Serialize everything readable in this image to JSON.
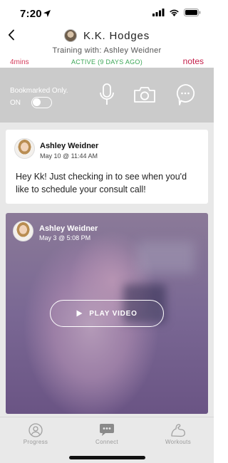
{
  "status_bar": {
    "time": "7:20"
  },
  "header": {
    "title": "K.K. Hodges",
    "trainer_line": "Training with: Ashley Weidner",
    "mins": "4mins",
    "active_status": "ACTIVE (9 DAYS AGO)",
    "notes_label": "notes"
  },
  "toolbar": {
    "bookmarked_label": "Bookmarked Only.",
    "toggle_state_label": "ON",
    "icons": [
      "microphone-icon",
      "camera-icon",
      "chat-bubble-icon"
    ]
  },
  "messages": [
    {
      "sender": "Ashley Weidner",
      "timestamp": "May 10 @ 11:44 AM",
      "text": "Hey Kk! Just checking in to see when you'd like to schedule your consult call!"
    },
    {
      "sender": "Ashley Weidner",
      "timestamp": "May 3 @ 5:08 PM",
      "video_button_label": "PLAY VIDEO"
    }
  ],
  "tabs": [
    {
      "label": "Progress",
      "icon": "person-circle-icon"
    },
    {
      "label": "Connect",
      "icon": "chat-dots-icon"
    },
    {
      "label": "Workouts",
      "icon": "flexed-arm-icon"
    }
  ],
  "colors": {
    "accent_red": "#c41e4a",
    "active_green": "#3aa655",
    "toolbar_gray": "#cbcbcb",
    "connect_active": "#8a8a8a"
  }
}
